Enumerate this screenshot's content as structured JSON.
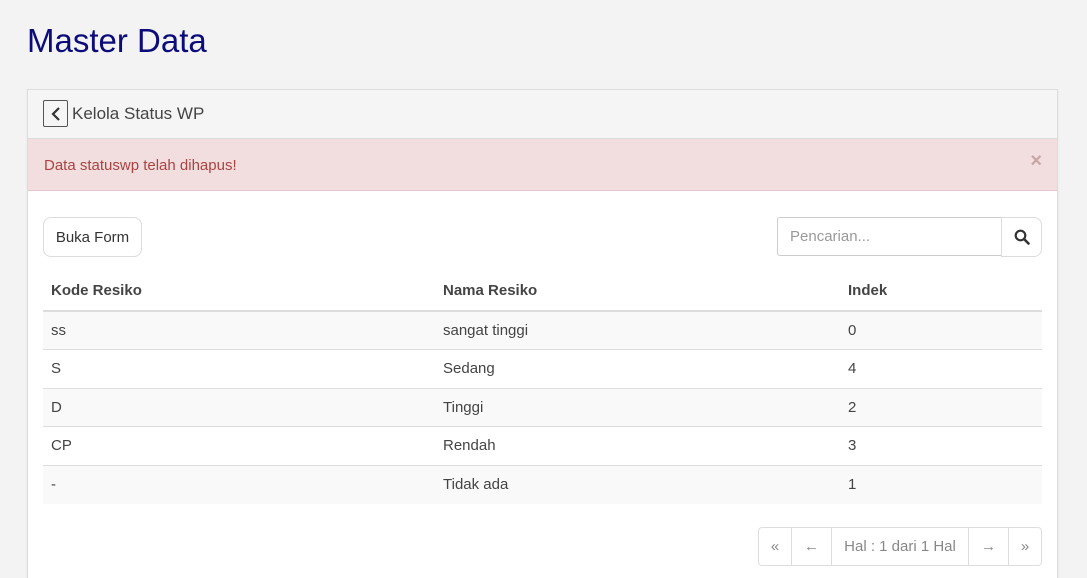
{
  "page": {
    "title": "Master Data"
  },
  "panel": {
    "title": "Kelola Status WP",
    "back_icon": "chevron-left-icon"
  },
  "alert": {
    "message": "Data statuswp telah dihapus!",
    "close_label": "×",
    "color": "#a94442",
    "background": "#f2dede"
  },
  "toolbar": {
    "open_form_label": "Buka Form",
    "search_placeholder": "Pencarian...",
    "search_icon": "search-icon"
  },
  "table": {
    "headers": [
      "Kode Resiko",
      "Nama Resiko",
      "Indek"
    ],
    "rows": [
      [
        "ss",
        "sangat tinggi",
        "0"
      ],
      [
        "S",
        "Sedang",
        "4"
      ],
      [
        "D",
        "Tinggi",
        "2"
      ],
      [
        "CP",
        "Rendah",
        "3"
      ],
      [
        "-",
        "Tidak ada",
        "1"
      ]
    ]
  },
  "pagination": {
    "first": "«",
    "prev": "←",
    "info": "Hal : 1 dari 1 Hal",
    "next": "→",
    "last": "»"
  },
  "colors": {
    "title": "#0b0b7a"
  }
}
